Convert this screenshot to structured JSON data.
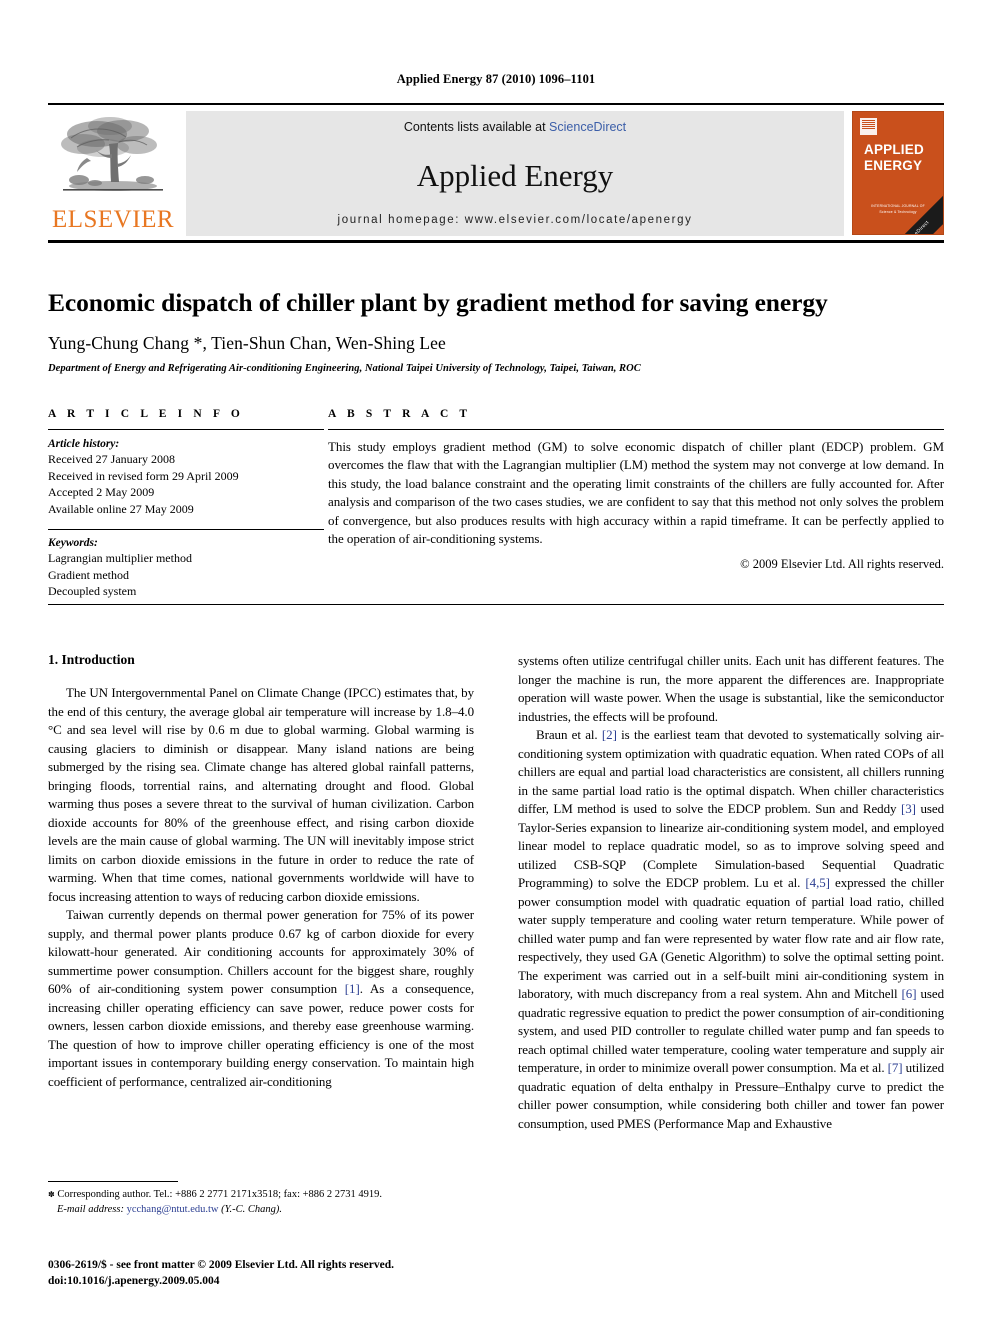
{
  "running_head": "Applied Energy 87 (2010) 1096–1101",
  "masthead": {
    "elsevier_wordmark": "ELSEVIER",
    "contents_prefix": "Contents lists available at ",
    "contents_link": "ScienceDirect",
    "journal_name": "Applied Energy",
    "homepage": "journal homepage: www.elsevier.com/locate/apenergy",
    "cover": {
      "line1": "APPLIED",
      "line2": "ENERGY",
      "footer_line1": "INTERNATIONAL JOURNAL OF",
      "footer_line2": "Science & Technology",
      "ribbon": "ScienceDirect"
    }
  },
  "article": {
    "title": "Economic dispatch of chiller plant by gradient method for saving energy",
    "authors": "Yung-Chung Chang *, Tien-Shun Chan, Wen-Shing Lee",
    "affiliation": "Department of Energy and Refrigerating Air-conditioning Engineering, National Taipei University of Technology, Taipei, Taiwan, ROC"
  },
  "article_info": {
    "heading": "A R T I C L E   I N F O",
    "history_label": "Article history:",
    "history": [
      "Received 27 January 2008",
      "Received in revised form 29 April 2009",
      "Accepted 2 May 2009",
      "Available online 27 May 2009"
    ],
    "keywords_label": "Keywords:",
    "keywords": [
      "Lagrangian multiplier method",
      "Gradient method",
      "Decoupled system"
    ]
  },
  "abstract": {
    "heading": "A B S T R A C T",
    "text": "This study employs gradient method (GM) to solve economic dispatch of chiller plant (EDCP) problem. GM overcomes the flaw that with the Lagrangian multiplier (LM) method the system may not converge at low demand. In this study, the load balance constraint and the operating limit constraints of the chillers are fully accounted for. After analysis and comparison of the two cases studies, we are confident to say that this method not only solves the problem of convergence, but also produces results with high accuracy within a rapid timeframe. It can be perfectly applied to the operation of air-conditioning systems.",
    "copyright": "© 2009 Elsevier Ltd. All rights reserved."
  },
  "body": {
    "section_title": "1. Introduction",
    "left_paragraphs": [
      "The UN Intergovernmental Panel on Climate Change (IPCC) estimates that, by the end of this century, the average global air temperature will increase by 1.8–4.0 °C and sea level will rise by 0.6 m due to global warming. Global warming is causing glaciers to diminish or disappear. Many island nations are being submerged by the rising sea. Climate change has altered global rainfall patterns, bringing floods, torrential rains, and alternating drought and flood. Global warming thus poses a severe threat to the survival of human civilization. Carbon dioxide accounts for 80% of the greenhouse effect, and rising carbon dioxide levels are the main cause of global warming. The UN will inevitably impose strict limits on carbon dioxide emissions in the future in order to reduce the rate of warming. When that time comes, national governments worldwide will have to focus increasing attention to ways of reducing carbon dioxide emissions."
    ],
    "left_para2_a": "Taiwan currently depends on thermal power generation for 75% of its power supply, and thermal power plants produce 0.67 kg of carbon dioxide for every kilowatt-hour generated. Air conditioning accounts for approximately 30% of summertime power consumption. Chillers account for the biggest share, roughly 60% of air-conditioning system power consumption ",
    "left_para2_ref": "[1]",
    "left_para2_b": ". As a consequence, increasing chiller operating efficiency can save power, reduce power costs for owners, lessen carbon dioxide emissions, and thereby ease greenhouse warming. The question of how to improve chiller operating efficiency is one of the most important issues in contemporary building energy conservation. To maintain high coefficient of performance, centralized air-conditioning",
    "right_para1": "systems often utilize centrifugal chiller units. Each unit has different features. The longer the machine is run, the more apparent the differences are. Inappropriate operation will waste power. When the usage is substantial, like the semiconductor industries, the effects will be profound.",
    "right_para2_a": "Braun et al. ",
    "right_para2_ref1": "[2]",
    "right_para2_b": " is the earliest team that devoted to systematically solving air-conditioning system optimization with quadratic equation. When rated COPs of all chillers are equal and partial load characteristics are consistent, all chillers running in the same partial load ratio is the optimal dispatch. When chiller characteristics differ, LM method is used to solve the EDCP problem. Sun and Reddy ",
    "right_para2_ref2": "[3]",
    "right_para2_c": " used Taylor-Series expansion to linearize air-conditioning system model, and employed linear model to replace quadratic model, so as to improve solving speed and utilized CSB-SQP (Complete Simulation-based Sequential Quadratic Programming) to solve the EDCP problem. Lu et al. ",
    "right_para2_ref3": "[4,5]",
    "right_para2_d": " expressed the chiller power consumption model with quadratic equation of partial load ratio, chilled water supply temperature and cooling water return temperature. While power of chilled water pump and fan were represented by water flow rate and air flow rate, respectively, they used GA (Genetic Algorithm) to solve the optimal setting point. The experiment was carried out in a self-built mini air-conditioning system in laboratory, with much discrepancy from a real system. Ahn and Mitchell ",
    "right_para2_ref4": "[6]",
    "right_para2_e": " used quadratic regressive equation to predict the power consumption of air-conditioning system, and used PID controller to regulate chilled water pump and fan speeds to reach optimal chilled water temperature, cooling water temperature and supply air temperature, in order to minimize overall power consumption. Ma et al. ",
    "right_para2_ref5": "[7]",
    "right_para2_f": " utilized quadratic equation of delta enthalpy in Pressure–Enthalpy curve to predict the chiller power consumption, while considering both chiller and tower fan power consumption, used PMES (Performance Map and Exhaustive"
  },
  "footnotes": {
    "corresponding": "Corresponding author. Tel.: +886 2 2771 2171x3518; fax: +886 2 2731 4919.",
    "email_label": "E-mail address: ",
    "email": "ycchang@ntut.edu.tw",
    "email_suffix": " (Y.-C. Chang).",
    "issn_line": "0306-2619/$ - see front matter © 2009 Elsevier Ltd. All rights reserved.",
    "doi_line": "doi:10.1016/j.apenergy.2009.05.004"
  },
  "colors": {
    "elsevier_orange": "#E87722",
    "link_blue": "#3b5ea8",
    "reference_blue": "#2c3f92",
    "cover_orange": "#C9501C",
    "band_gray": "#e6e6e6"
  }
}
